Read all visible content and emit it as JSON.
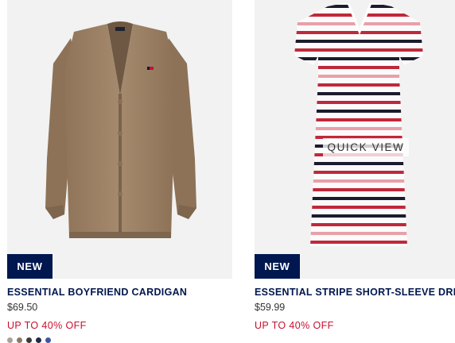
{
  "products": [
    {
      "badge": "NEW",
      "name": "ESSENTIAL BOYFRIEND CARDIGAN",
      "price": "$69.50",
      "promo": "UP TO 40% OFF",
      "swatches": [
        "#a8a39a",
        "#8b7a66",
        "#3a3a3a",
        "#1f2a44",
        "#3a56a8"
      ]
    },
    {
      "badge": "NEW",
      "name": "ESSENTIAL STRIPE SHORT-SLEEVE DRESS",
      "price": "$59.99",
      "promo": "UP TO 40% OFF",
      "quick_view": "QUICK VIEW"
    }
  ]
}
